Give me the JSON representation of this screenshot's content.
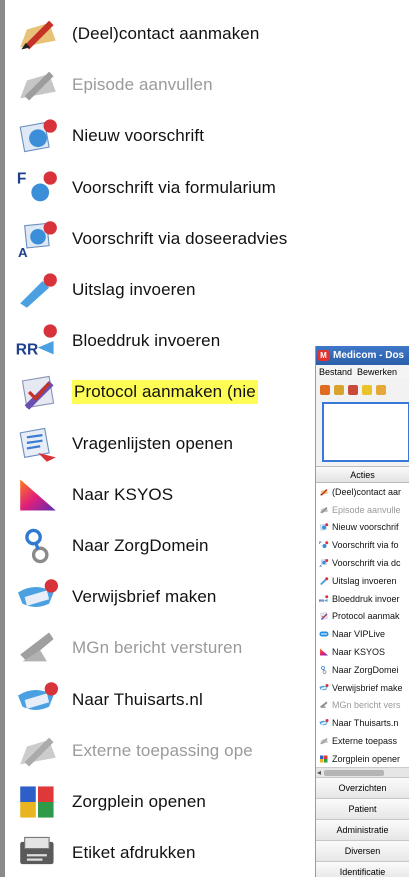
{
  "actions": [
    {
      "label": "(Deel)contact aanmaken",
      "icon": "contact-pen-icon",
      "disabled": false,
      "highlight": false
    },
    {
      "label": "Episode aanvullen",
      "icon": "episode-pen-icon",
      "disabled": true,
      "highlight": false
    },
    {
      "label": "Nieuw voorschrift",
      "icon": "prescription-icon",
      "disabled": false,
      "highlight": false
    },
    {
      "label": "Voorschrift via formularium",
      "icon": "formulary-prescription-icon",
      "disabled": false,
      "highlight": false
    },
    {
      "label": "Voorschrift via doseeradvies",
      "icon": "dosage-prescription-icon",
      "disabled": false,
      "highlight": false
    },
    {
      "label": "Uitslag invoeren",
      "icon": "result-entry-icon",
      "disabled": false,
      "highlight": false
    },
    {
      "label": "Bloeddruk invoeren",
      "icon": "blood-pressure-icon",
      "disabled": false,
      "highlight": false
    },
    {
      "label": "Protocol aanmaken (nie",
      "icon": "protocol-pen-icon",
      "disabled": false,
      "highlight": true
    },
    {
      "label": "Vragenlijsten openen",
      "icon": "questionnaire-icon",
      "disabled": false,
      "highlight": false
    },
    {
      "label": "Naar KSYOS",
      "icon": "ksyos-logo-icon",
      "disabled": false,
      "highlight": false
    },
    {
      "label": "Naar ZorgDomein",
      "icon": "zorgdomein-icon",
      "disabled": false,
      "highlight": false
    },
    {
      "label": "Verwijsbrief maken",
      "icon": "referral-letter-icon",
      "disabled": false,
      "highlight": false
    },
    {
      "label": "MGn bericht versturen",
      "icon": "mgn-message-icon",
      "disabled": true,
      "highlight": false
    },
    {
      "label": "Naar Thuisarts.nl",
      "icon": "thuisarts-icon",
      "disabled": false,
      "highlight": false
    },
    {
      "label": "Externe toepassing ope",
      "icon": "external-app-icon",
      "disabled": true,
      "highlight": false
    },
    {
      "label": "Zorgplein openen",
      "icon": "zorgplein-puzzle-icon",
      "disabled": false,
      "highlight": false
    },
    {
      "label": "Etiket afdrukken",
      "icon": "label-print-icon",
      "disabled": false,
      "highlight": false
    }
  ],
  "mini_window": {
    "title": "Medicom - Dos",
    "app_icon": "M",
    "menu": [
      "Bestand",
      "Bewerken"
    ],
    "acties_label": "Acties",
    "items": [
      {
        "label": "(Deel)contact aar",
        "icon": "contact-pen-icon",
        "disabled": false
      },
      {
        "label": "Episode aanvulle",
        "icon": "episode-pen-icon",
        "disabled": true
      },
      {
        "label": "Nieuw voorschrif",
        "icon": "prescription-icon",
        "disabled": false
      },
      {
        "label": "Voorschrift via fo",
        "icon": "formulary-prescription-icon",
        "disabled": false
      },
      {
        "label": "Voorschrift via dc",
        "icon": "dosage-prescription-icon",
        "disabled": false
      },
      {
        "label": "Uitslag invoeren",
        "icon": "result-entry-icon",
        "disabled": false
      },
      {
        "label": "Bloeddruk invoer",
        "icon": "blood-pressure-icon",
        "disabled": false
      },
      {
        "label": "Protocol aanmak",
        "icon": "protocol-pen-icon",
        "disabled": false
      },
      {
        "label": "Naar VIPLive",
        "icon": "viplive-icon",
        "disabled": false
      },
      {
        "label": "Naar KSYOS",
        "icon": "ksyos-logo-icon",
        "disabled": false
      },
      {
        "label": "Naar ZorgDomei",
        "icon": "zorgdomein-icon",
        "disabled": false
      },
      {
        "label": "Verwijsbrief make",
        "icon": "referral-letter-icon",
        "disabled": false
      },
      {
        "label": "MGn bericht vers",
        "icon": "mgn-message-icon",
        "disabled": true
      },
      {
        "label": "Naar Thuisarts.n",
        "icon": "thuisarts-icon",
        "disabled": false
      },
      {
        "label": "Externe toepass",
        "icon": "external-app-icon",
        "disabled": false
      },
      {
        "label": "Zorgplein opener",
        "icon": "zorgplein-puzzle-icon",
        "disabled": false
      }
    ],
    "nav": [
      "Overzichten",
      "Patient",
      "Administratie",
      "Diversen",
      "Identificatie"
    ]
  },
  "colors": {
    "highlight": "#fdfd55",
    "title_bar": "#2a5ea8",
    "focus_border": "#3a78d8",
    "disabled_text": "#9a9a9a"
  }
}
